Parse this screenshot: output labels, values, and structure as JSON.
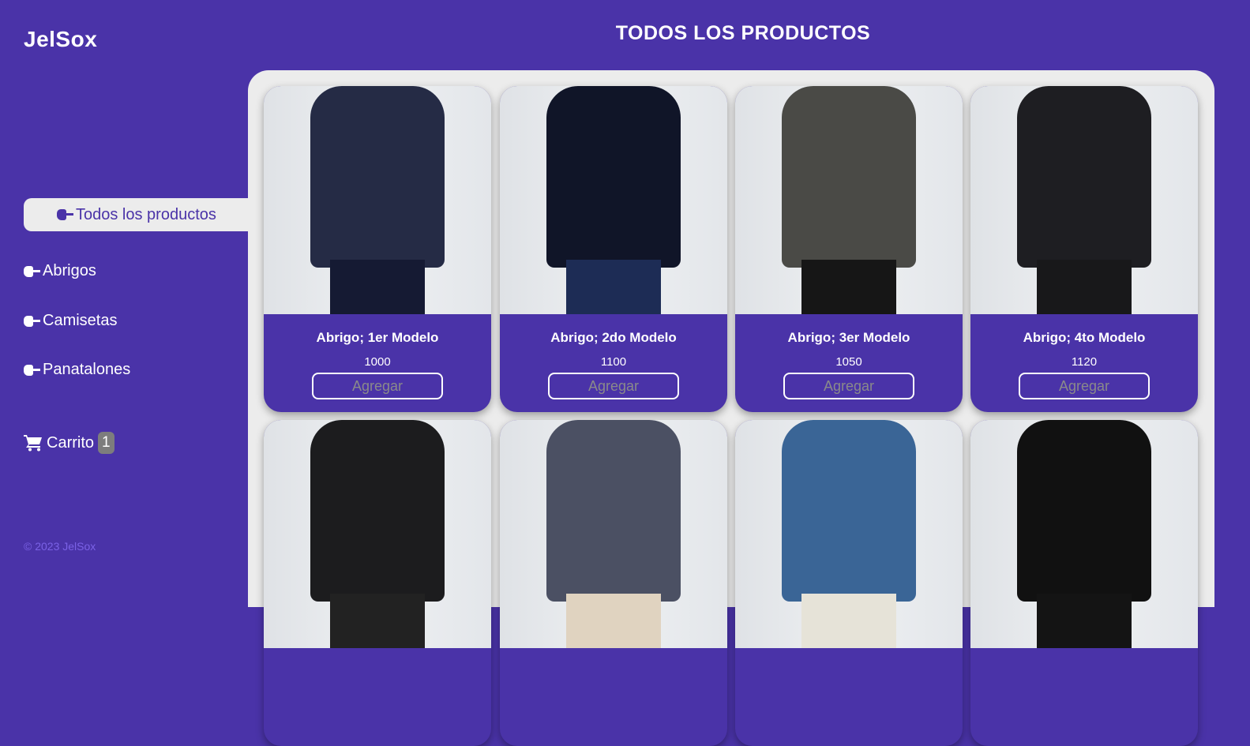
{
  "brand": "JelSox",
  "page_title": "TODOS LOS PRODUCTOS",
  "nav": [
    {
      "label": "Todos los productos",
      "icon": "hand-point-right-icon",
      "active": true
    },
    {
      "label": "Abrigos",
      "icon": "hand-point-right-icon"
    },
    {
      "label": "Camisetas",
      "icon": "hand-point-right-icon"
    },
    {
      "label": "Panatalones",
      "icon": "hand-point-right-icon"
    }
  ],
  "cart": {
    "label": "Carrito",
    "count": "1",
    "icon": "cart-icon"
  },
  "footer": "© 2023 JelSox",
  "colors": {
    "primary": "#4a33a8",
    "panel": "#ececec",
    "badge": "#7d7d7d"
  },
  "products": [
    {
      "name": "Abrigo; 1er Modelo",
      "price": "1000",
      "button": "Agregar",
      "top": "#252b45",
      "bottom": "#151a33"
    },
    {
      "name": "Abrigo; 2do Modelo",
      "price": "1100",
      "button": "Agregar",
      "top": "#101528",
      "bottom": "#1d2c55"
    },
    {
      "name": "Abrigo; 3er Modelo",
      "price": "1050",
      "button": "Agregar",
      "top": "#4a4a46",
      "bottom": "#161616"
    },
    {
      "name": "Abrigo; 4to Modelo",
      "price": "1120",
      "button": "Agregar",
      "top": "#1e1e22",
      "bottom": "#18181a"
    },
    {
      "top": "#1c1c1e",
      "bottom": "#222"
    },
    {
      "top": "#4b5063",
      "bottom": "#e0d3c0"
    },
    {
      "top": "#3a6596",
      "bottom": "#e6e3d8"
    },
    {
      "top": "#111",
      "bottom": "#141414"
    }
  ]
}
